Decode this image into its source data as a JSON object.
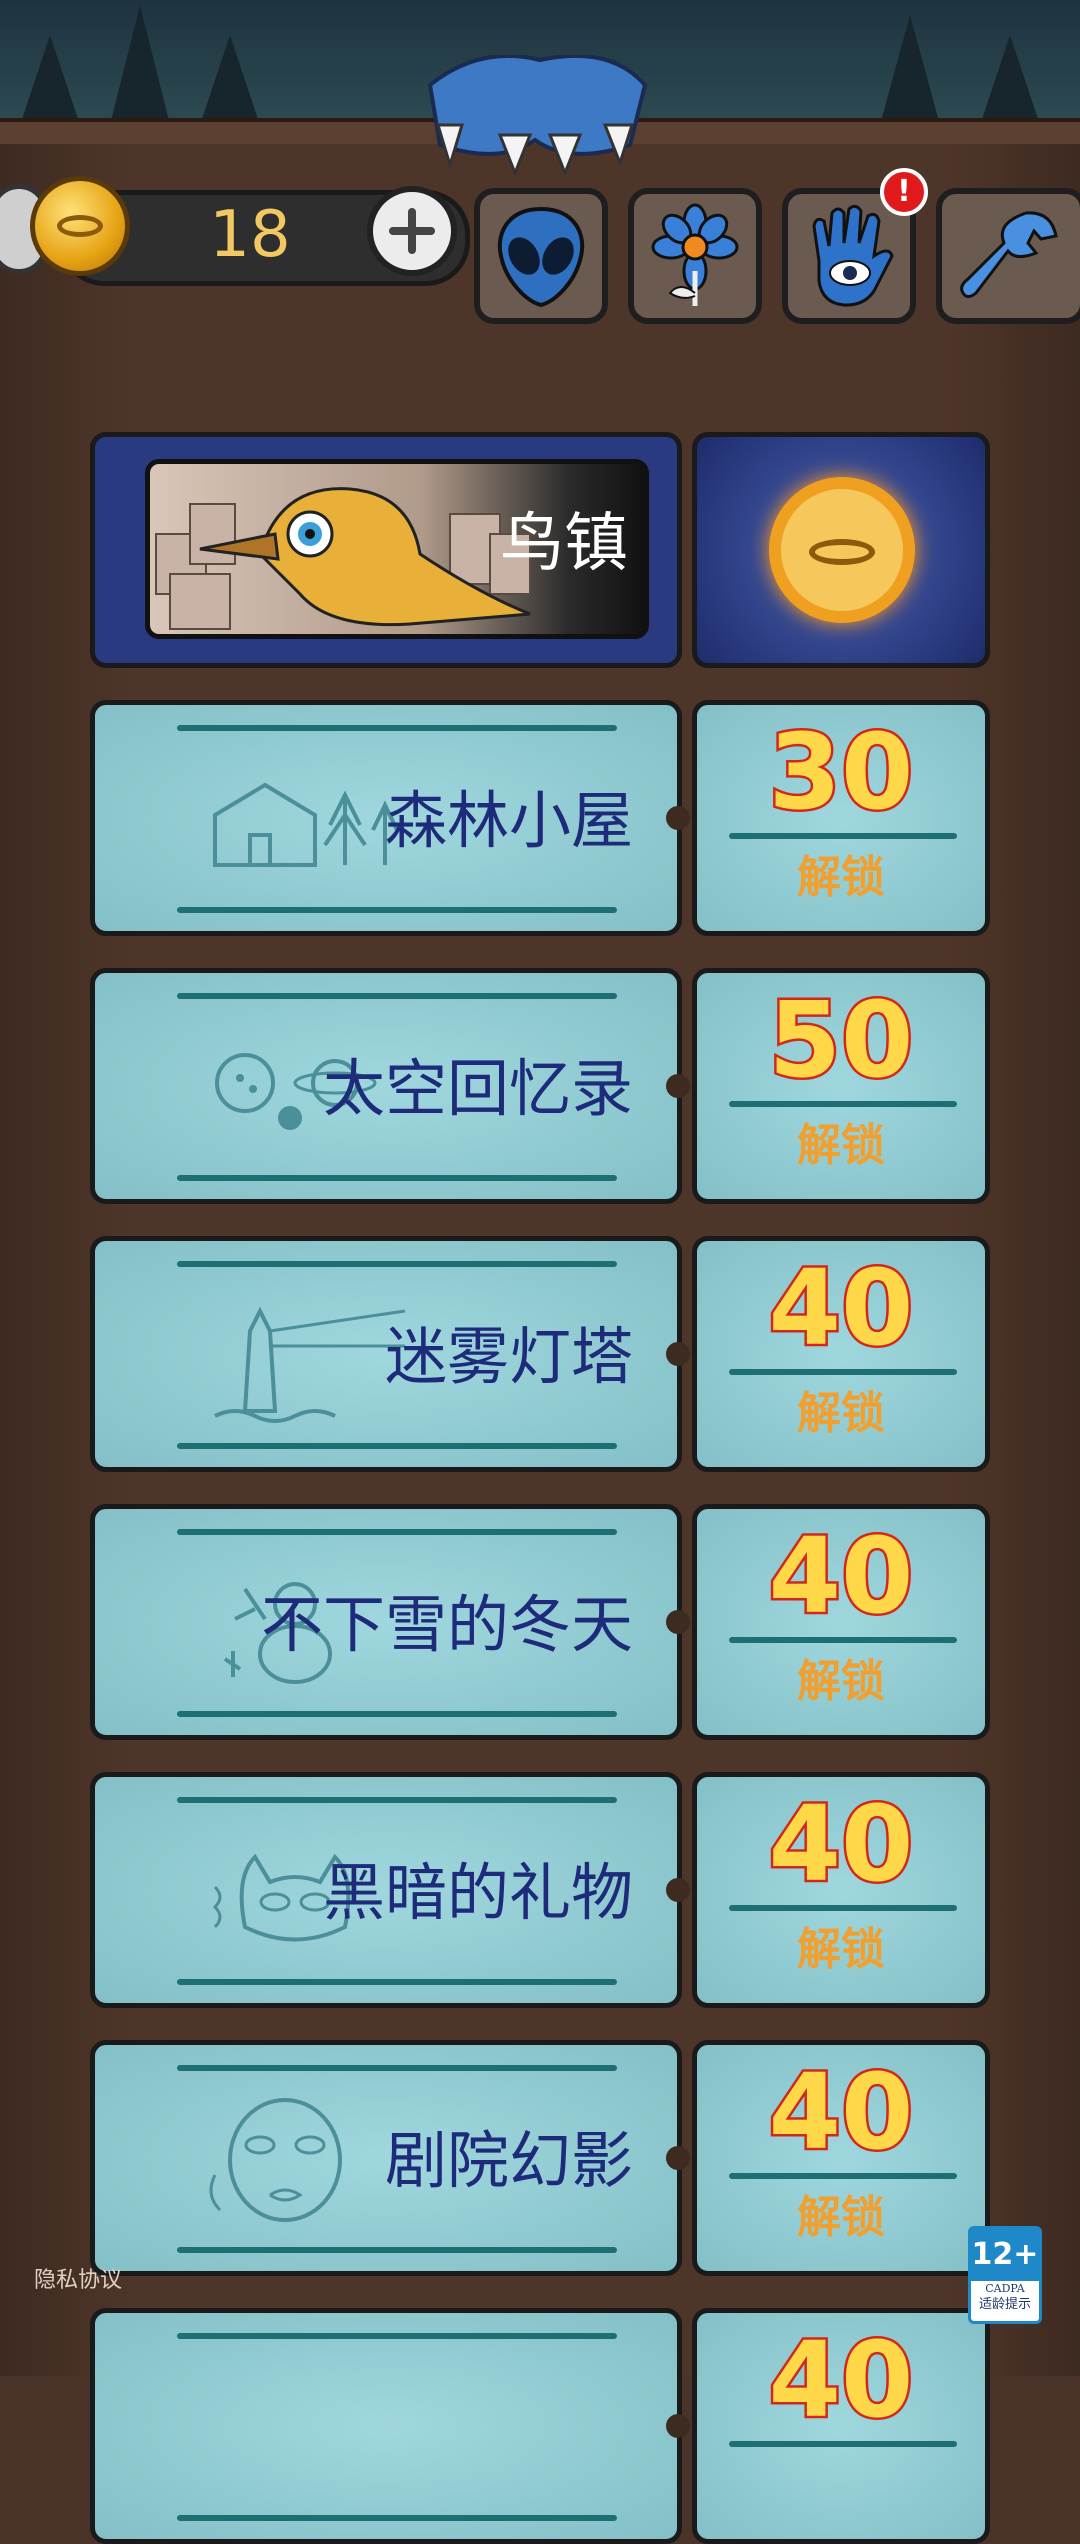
{
  "hud": {
    "coin_count": "18",
    "tools": [
      {
        "icon": "alien-icon"
      },
      {
        "icon": "flower-icon"
      },
      {
        "icon": "eye-hand-icon",
        "badge": "!"
      },
      {
        "icon": "wrench-icon"
      }
    ]
  },
  "featured": {
    "title": "鸟镇",
    "status_icon": "coin-icon"
  },
  "levels": [
    {
      "title": "森林小屋",
      "sketch": "house-trees-sketch",
      "price": "30",
      "action": "解锁"
    },
    {
      "title": "太空回忆录",
      "sketch": "planets-sketch",
      "price": "50",
      "action": "解锁"
    },
    {
      "title": "迷雾灯塔",
      "sketch": "lighthouse-sketch",
      "price": "40",
      "action": "解锁"
    },
    {
      "title": "不下雪的冬天",
      "sketch": "snowman-sketch",
      "price": "40",
      "action": "解锁"
    },
    {
      "title": "黑暗的礼物",
      "sketch": "cat-sketch",
      "price": "40",
      "action": "解锁"
    },
    {
      "title": "剧院幻影",
      "sketch": "face-sketch",
      "price": "40",
      "action": "解锁"
    },
    {
      "title": "",
      "sketch": "",
      "price": "40",
      "action": ""
    }
  ],
  "footer": {
    "privacy_link": "隐私协议",
    "age_rating": "12+",
    "age_org": "CADPA",
    "age_hint": "适龄提示"
  },
  "colors": {
    "ticket": "#8fd0d8",
    "title_text": "#1e2a7a",
    "price_fill": "#ffd84a",
    "price_stroke": "#d2281c",
    "featured_bg": "#2a3a80"
  }
}
